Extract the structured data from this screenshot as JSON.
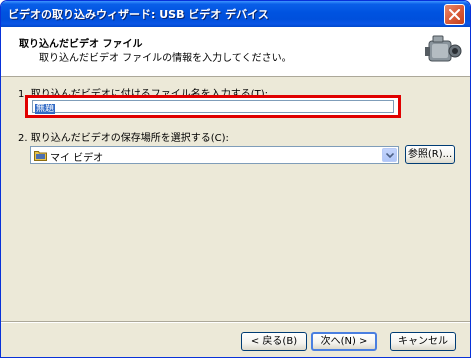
{
  "window": {
    "title": "ビデオの取り込みウィザード: USB ビデオ デバイス"
  },
  "header": {
    "title": "取り込んだビデオ ファイル",
    "subtitle": "取り込んだビデオ ファイルの情報を入力してください。",
    "icon": "camcorder-icon"
  },
  "step1": {
    "label": "1. 取り込んだビデオに付けるファイル名を入力する(T):",
    "input_value": "無題"
  },
  "step2": {
    "label": "2. 取り込んだビデオの保存場所を選択する(C):",
    "selected_location": "マイ ビデオ",
    "browse_label": "参照(R)..."
  },
  "buttons": {
    "back": "< 戻る(B)",
    "next": "次へ(N) >",
    "cancel": "キャンセル"
  },
  "colors": {
    "highlight": "#e00000",
    "titlebar": "#0053e0",
    "dialog_bg": "#ece9d8"
  }
}
